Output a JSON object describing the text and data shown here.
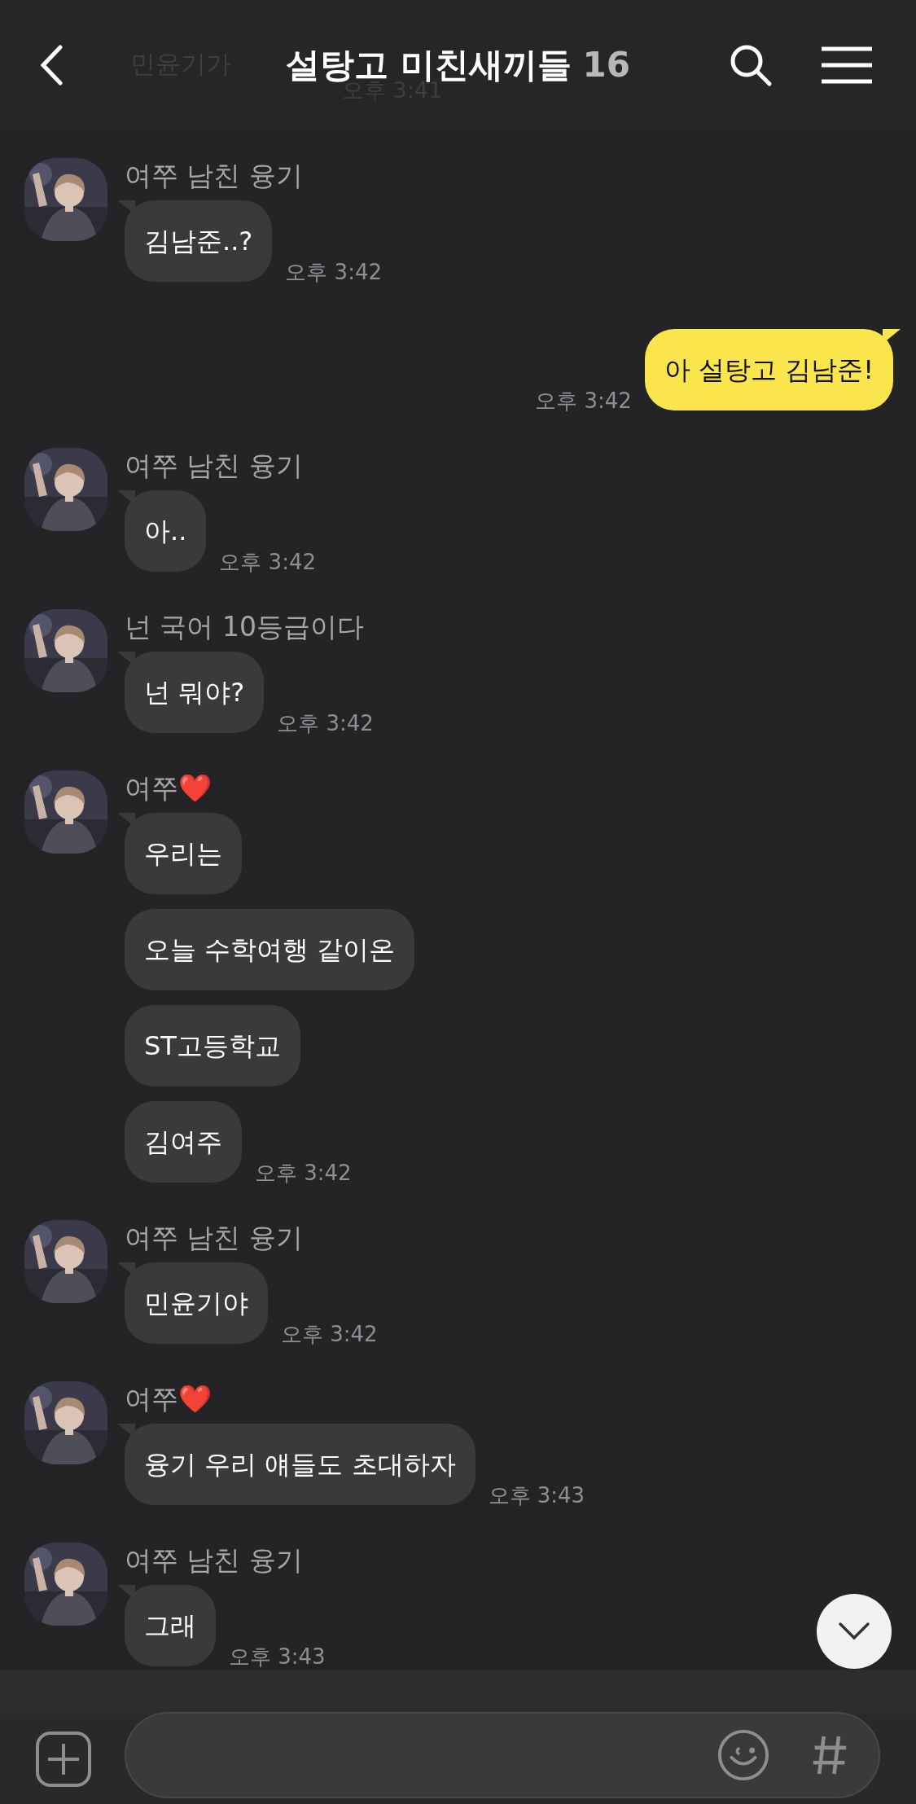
{
  "header": {
    "title": "설탕고 미친새끼들",
    "member_count": "16"
  },
  "faded_message": {
    "text": "민윤기가",
    "time": "오후 3:41"
  },
  "messages": [
    {
      "kind": "received",
      "sender": "여쭈 남친 융기",
      "bubbles": [
        "김남준..?"
      ],
      "time": "오후 3:42"
    },
    {
      "kind": "sent",
      "bubbles": [
        "아 설탕고 김남준!"
      ],
      "time": "오후 3:42"
    },
    {
      "kind": "received",
      "sender": "여쭈 남친 융기",
      "bubbles": [
        "아.."
      ],
      "time": "오후 3:42"
    },
    {
      "kind": "received",
      "sender": "넌 국어 10등급이다",
      "bubbles": [
        "넌 뭐야?"
      ],
      "time": "오후 3:42"
    },
    {
      "kind": "received",
      "sender": "여쭈❤️",
      "bubbles": [
        "우리는",
        "오늘 수학여행 같이온",
        "ST고등학교",
        "김여주"
      ],
      "time": "오후 3:42"
    },
    {
      "kind": "received",
      "sender": "여쭈 남친 융기",
      "bubbles": [
        "민윤기야"
      ],
      "time": "오후 3:42"
    },
    {
      "kind": "received",
      "sender": "여쭈❤️",
      "bubbles": [
        "융기 우리 얘들도 초대하자"
      ],
      "time": "오후 3:43"
    },
    {
      "kind": "received",
      "sender": "여쭈 남친 융기",
      "bubbles": [
        "그래"
      ],
      "time": "오후 3:43"
    }
  ]
}
